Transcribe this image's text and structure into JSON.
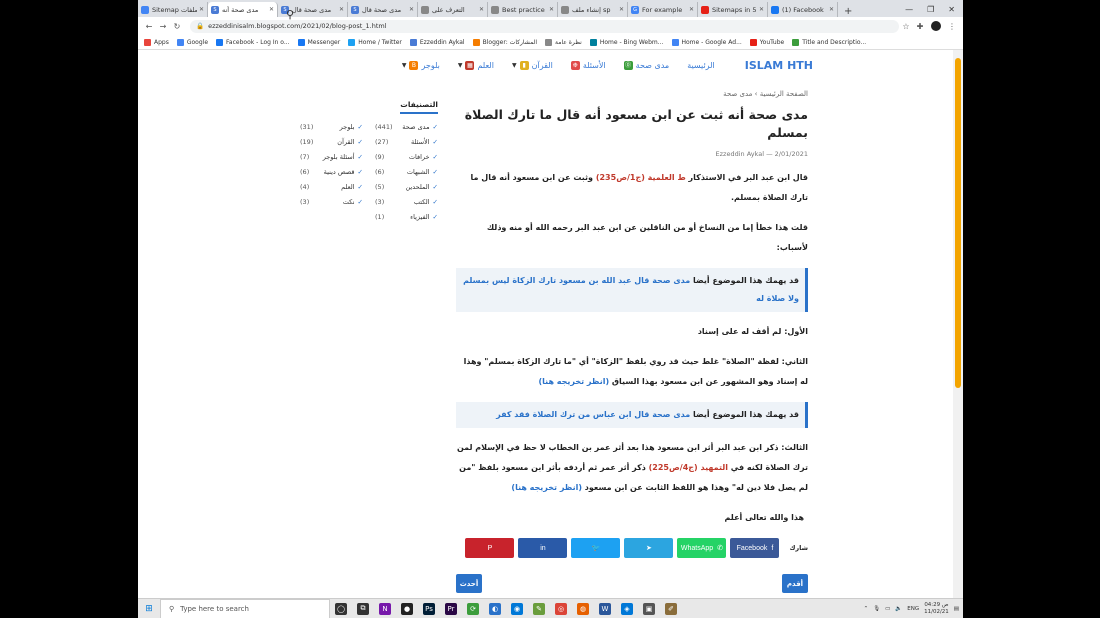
{
  "tabs": [
    {
      "label": "Sitemap ملفات",
      "icon_color": "#4285f4",
      "active": false
    },
    {
      "label": "مدى صحة أنه",
      "icon_color": "#4a7bd5",
      "icon": "S",
      "active": true
    },
    {
      "label": "مدى صحة قال",
      "icon_color": "#4a7bd5",
      "icon": "S",
      "active": false
    },
    {
      "label": "مدى صحة قال",
      "icon_color": "#4a7bd5",
      "icon": "S",
      "active": false
    },
    {
      "label": "التعرف على",
      "icon_color": "#888",
      "active": false
    },
    {
      "label": "Best practice",
      "icon_color": "#888",
      "active": false
    },
    {
      "label": "إنشاء ملف sp",
      "icon_color": "#888",
      "active": false
    },
    {
      "label": "For example",
      "icon_color": "#4285f4",
      "icon": "G",
      "active": false
    },
    {
      "label": "Sitemaps in 5",
      "icon_color": "#e62117",
      "active": false
    },
    {
      "label": "(1) Facebook",
      "icon_color": "#1877f2",
      "active": false
    }
  ],
  "newtab": "+",
  "window_controls": [
    "—",
    "❐",
    "✕"
  ],
  "url": "ezzeddinisalm.blogspot.com/2021/02/blog-post_1.html",
  "bookmarks": [
    {
      "label": "Apps",
      "color": "#e8453c"
    },
    {
      "label": "Google",
      "color": "#4285f4"
    },
    {
      "label": "Facebook - Log In o...",
      "color": "#1877f2"
    },
    {
      "label": "Messenger",
      "color": "#1877f2"
    },
    {
      "label": "Home / Twitter",
      "color": "#1da1f2"
    },
    {
      "label": "Ezzeddin Aykal",
      "color": "#4a7bd5"
    },
    {
      "label": "Blogger: المشاركات",
      "color": "#f57d00"
    },
    {
      "label": "نظرة عامة",
      "color": "#888"
    },
    {
      "label": "Home - Bing Webm...",
      "color": "#00809d"
    },
    {
      "label": "Home - Google Ad...",
      "color": "#4285f4"
    },
    {
      "label": "YouTube",
      "color": "#e62117"
    },
    {
      "label": "Title and Descriptio...",
      "color": "#3c9d3c"
    }
  ],
  "site": {
    "logo": "ISLAM HTH",
    "menu": [
      {
        "label": "الرئيسية",
        "icon": "",
        "color": "#3a7bd5",
        "caret": false
      },
      {
        "label": "مدى صحة",
        "icon": "⓪",
        "color": "#3a9d3a",
        "caret": false
      },
      {
        "label": "الأسئلة",
        "icon": "❉",
        "color": "#e04a4a",
        "caret": false
      },
      {
        "label": "القرآن",
        "icon": "▮",
        "color": "#e0b020",
        "caret": true
      },
      {
        "label": "العلم",
        "icon": "▦",
        "color": "#c0392b",
        "caret": true
      },
      {
        "label": "بلوجر",
        "icon": "B",
        "color": "#f57d00",
        "caret": true
      }
    ],
    "search_icon": "⚲"
  },
  "article": {
    "breadcrumb_home": "الصفحة الرئيسية",
    "breadcrumb_sep": "›",
    "breadcrumb_cat": "مدى صحة",
    "title": "مدى صحة أنه ثبت عن ابن مسعود أنه قال ما تارك الصلاة بمسلم",
    "date": "2/01/2021",
    "dash": "—",
    "author": "Ezzeddin Aykal",
    "p1_a": "قال ابن عبد البر في الاستذكار ",
    "p1_red": "ط العلمية (ج1/ص235)",
    "p1_b": " وثبت عن ابن مسعود أنه قال ما تارك الصلاة بمسلم.",
    "p2": "قلت هذا خطأ إما من النساخ أو من الناقلين عن ابن عبد البر رحمه الله أو منه وذلك لأسباب:",
    "box1_pre": "قد يهمك هذا الموضوع أيضا ",
    "box1_link": "مدى صحة قال عبد الله بن مسعود تارك الزكاة ليس بمسلم ولا صلاة له",
    "p3": "الأول: لم أقف له على إسناد",
    "p4_a": "الثاني: لفظة \"الصلاة\" غلط حيث قد روي بلفظ \"الزكاة\" أي \"ما تارك الزكاة بمسلم\" وهذا له إسناد وهو المشهور عن ابن مسعود بهذا السياق ",
    "p4_link": "(انظر تخريجه هنا)",
    "box2_pre": "قد يهمك هذا الموضوع أيضا ",
    "box2_link": "مدى صحة قال ابن عباس من ترك الصلاة فقد كفر",
    "p5_a": "الثالث: ذكر ابن عبد البر أثر ابن مسعود هذا بعد أثر عمر بن الخطاب لا حظ في الإسلام لمن ترك الصلاة لكنه في ",
    "p5_red": "التمهيد (ج4/ص225)",
    "p5_b": " ذكر أثر عمر ثم أردفه بأثر ابن مسعود بلفظ \"من لم يصل فلا دين له\" وهذا هو اللفظ الثابت عن ابن مسعود ",
    "p5_link": "(انظر تخريجه هنا)",
    "closing": "هذا والله تعالى أعلم",
    "share_label": "شارك",
    "share": [
      {
        "label": "Facebook",
        "icon": "f",
        "color": "#3b5998"
      },
      {
        "label": "WhatsApp",
        "icon": "✆",
        "color": "#25d366"
      },
      {
        "label": "",
        "icon": "➤",
        "color": "#2ca5e0"
      },
      {
        "label": "",
        "icon": "🐦",
        "color": "#1da1f2"
      },
      {
        "label": "",
        "icon": "in",
        "color": "#2a5aa8"
      },
      {
        "label": "",
        "icon": "P",
        "color": "#c8232c"
      }
    ],
    "older": "أقدم",
    "newer": "أحدث"
  },
  "sidebar": {
    "title": "التصنيفات",
    "labels": [
      {
        "name": "مدى صحة",
        "count": "(441)"
      },
      {
        "name": "بلوجر",
        "count": "(31)"
      },
      {
        "name": "الأسئلة",
        "count": "(27)"
      },
      {
        "name": "القرآن",
        "count": "(19)"
      },
      {
        "name": "خرافات",
        "count": "(9)"
      },
      {
        "name": "أسئلة بلوجر",
        "count": "(7)"
      },
      {
        "name": "الشبهات",
        "count": "(6)"
      },
      {
        "name": "قصص دينية",
        "count": "(6)"
      },
      {
        "name": "الملحدين",
        "count": "(5)"
      },
      {
        "name": "العلم",
        "count": "(4)"
      },
      {
        "name": "الكتب",
        "count": "(3)"
      },
      {
        "name": "نكت",
        "count": "(3)"
      },
      {
        "name": "الفيزياء",
        "count": "(1)"
      }
    ]
  },
  "taskbar": {
    "search_placeholder": "Type here to search",
    "apps": [
      {
        "icon": "◯",
        "color": "#333"
      },
      {
        "icon": "⧉",
        "color": "#333"
      },
      {
        "icon": "N",
        "color": "#7719aa"
      },
      {
        "icon": "●",
        "color": "#222"
      },
      {
        "icon": "Ps",
        "color": "#001e36"
      },
      {
        "icon": "Pr",
        "color": "#2a0845"
      },
      {
        "icon": "⟳",
        "color": "#3c9d3c"
      },
      {
        "icon": "◐",
        "color": "#2a72c9"
      },
      {
        "icon": "◉",
        "color": "#0078d7"
      },
      {
        "icon": "✎",
        "color": "#6a9d3c"
      },
      {
        "icon": "◎",
        "color": "#db4437"
      },
      {
        "icon": "◍",
        "color": "#e66000"
      },
      {
        "icon": "W",
        "color": "#2b579a"
      },
      {
        "icon": "◈",
        "color": "#0078d7"
      },
      {
        "icon": "▣",
        "color": "#555"
      },
      {
        "icon": "✐",
        "color": "#8a6d3b"
      }
    ],
    "lang": "ENG",
    "time": "ص 04:29",
    "date": "11/02/21"
  }
}
